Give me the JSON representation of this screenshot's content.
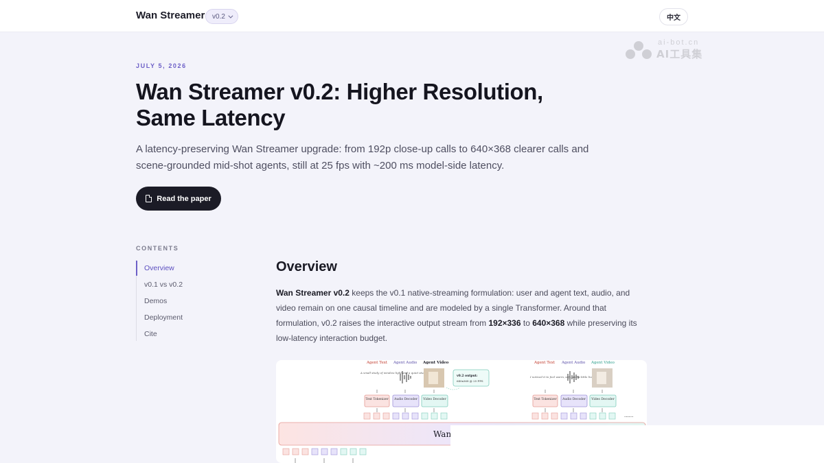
{
  "header": {
    "brand": "Wan Streamer",
    "version": "v0.2",
    "lang_button": "中文"
  },
  "watermark": {
    "small": "ai-bot.cn",
    "big": "AI工具集"
  },
  "hero": {
    "date": "JULY 5, 2026",
    "title": "Wan Streamer v0.2: Higher Resolution, Same Latency",
    "subtitle": "A latency-preserving Wan Streamer upgrade: from 192p close-up calls to 640×368 clearer calls and scene-grounded mid-shot agents, still at 25 fps with ~200 ms model-side latency.",
    "button": "Read the paper"
  },
  "toc": {
    "heading": "CONTENTS",
    "items": [
      "Overview",
      "v0.1 vs v0.2",
      "Demos",
      "Deployment",
      "Cite"
    ]
  },
  "overview": {
    "title": "Overview",
    "p_bold1": "Wan Streamer v0.2",
    "p_text1": " keeps the v0.1 native-streaming formulation: user and agent text, audio, and video remain on one causal timeline and are modeled by a single Transformer. Around that formulation, v0.2 raises the interactive output stream from ",
    "p_bold2": "192×336",
    "p_text2": " to ",
    "p_bold3": "640×368",
    "p_text3": " while preserving its low-latency interaction budget."
  },
  "figure": {
    "left": {
      "agent_text": "Agent Text",
      "agent_audio": "Agent Audio",
      "agent_video": "Agent Video",
      "caption": "A small study of window light and a quiet studio corner",
      "callout_title": "v0.2 output:",
      "callout_body": "640x368 @ 25 FPS",
      "tok": "Text Tokenizer",
      "adec": "Audio Decoder",
      "vdec": "Video Decoder"
    },
    "right": {
      "agent_text": "Agent Text",
      "agent_audio": "Agent Audio",
      "agent_video": "Agent Video",
      "caption": "I noticed it to feel warm, soft, and a little lived in.",
      "tok": "Text Tokenizer",
      "adec": "Audio Decoder",
      "vdec": "Video Decoder",
      "ellipsis": "......"
    },
    "transformer_label": "Wan"
  },
  "colors": {
    "accent": "#6c5fc7",
    "dark_button": "#1b1b26"
  }
}
